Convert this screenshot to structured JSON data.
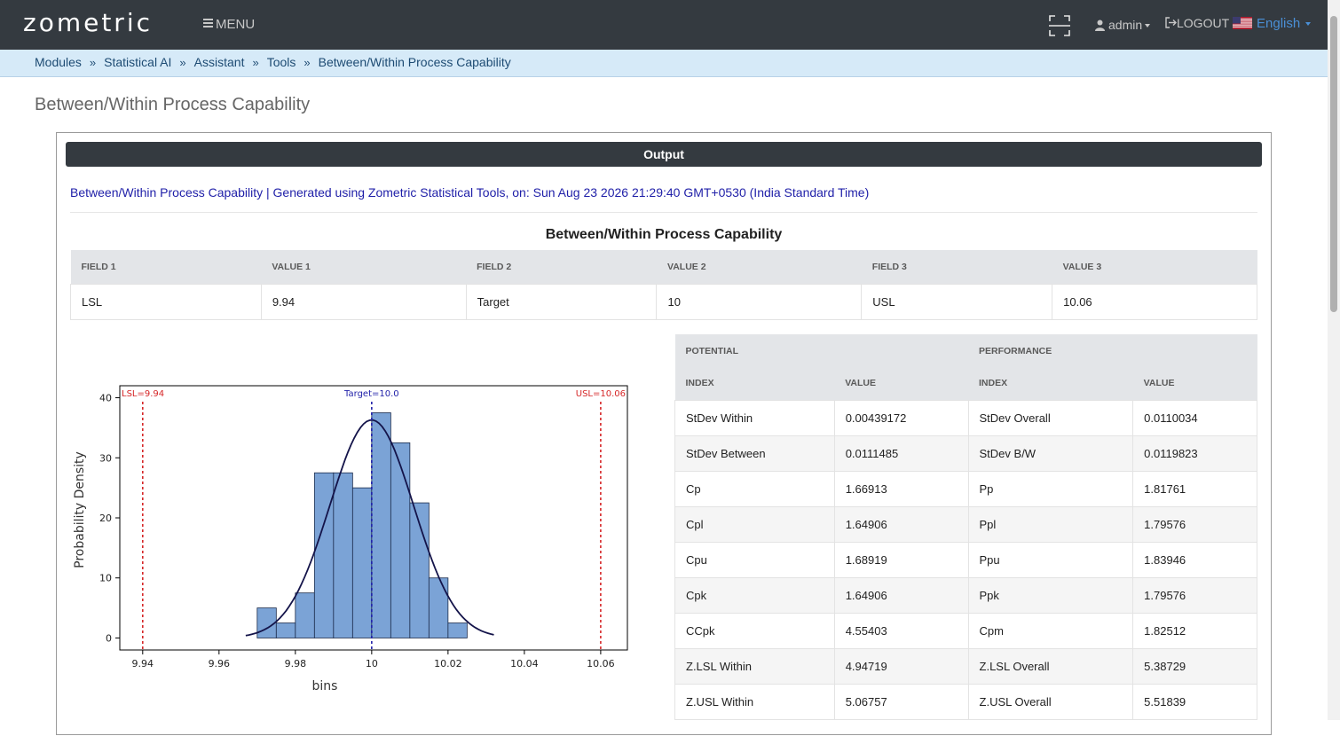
{
  "nav": {
    "logo": "zometric",
    "menu_label": "MENU",
    "user_label": "admin",
    "logout_label": "LOGOUT",
    "language_label": "English"
  },
  "breadcrumb": [
    "Modules",
    "Statistical AI",
    "Assistant",
    "Tools",
    "Between/Within Process Capability"
  ],
  "breadcrumb_sep": "»",
  "page_title": "Between/Within Process Capability",
  "output": {
    "header": "Output",
    "generated_text": "Between/Within Process Capability | Generated using Zometric Statistical Tools, on: Sun Aug 23 2026 21:29:40 GMT+0530 (India Standard Time)",
    "table_title": "Between/Within Process Capability"
  },
  "spec_table": {
    "headers": [
      "FIELD 1",
      "VALUE 1",
      "FIELD 2",
      "VALUE 2",
      "FIELD 3",
      "VALUE 3"
    ],
    "row": [
      "LSL",
      "9.94",
      "Target",
      "10",
      "USL",
      "10.06"
    ]
  },
  "capability_table": {
    "group_headers": [
      "POTENTIAL",
      "PERFORMANCE"
    ],
    "headers": [
      "INDEX",
      "VALUE",
      "INDEX",
      "VALUE"
    ],
    "rows": [
      [
        "StDev Within",
        "0.00439172",
        "StDev Overall",
        "0.0110034"
      ],
      [
        "StDev Between",
        "0.0111485",
        "StDev B/W",
        "0.0119823"
      ],
      [
        "Cp",
        "1.66913",
        "Pp",
        "1.81761"
      ],
      [
        "Cpl",
        "1.64906",
        "Ppl",
        "1.79576"
      ],
      [
        "Cpu",
        "1.68919",
        "Ppu",
        "1.83946"
      ],
      [
        "Cpk",
        "1.64906",
        "Ppk",
        "1.79576"
      ],
      [
        "CCpk",
        "4.55403",
        "Cpm",
        "1.82512"
      ],
      [
        "Z.LSL Within",
        "4.94719",
        "Z.LSL Overall",
        "5.38729"
      ],
      [
        "Z.USL Within",
        "5.06757",
        "Z.USL Overall",
        "5.51839"
      ]
    ]
  },
  "chart_data": {
    "type": "bar",
    "xlabel": "bins",
    "ylabel": "Probability Density",
    "xlim": [
      9.934,
      10.067
    ],
    "ylim": [
      -2,
      42
    ],
    "xticks": [
      9.94,
      9.96,
      9.98,
      10,
      10.02,
      10.04,
      10.06
    ],
    "xtick_labels": [
      "9.94",
      "9.96",
      "9.98",
      "10",
      "10.02",
      "10.04",
      "10.06"
    ],
    "yticks": [
      0,
      10,
      20,
      30,
      40
    ],
    "bin_width": 0.005,
    "bins": [
      {
        "x0": 9.97,
        "value": 5
      },
      {
        "x0": 9.975,
        "value": 2.5
      },
      {
        "x0": 9.98,
        "value": 7.5
      },
      {
        "x0": 9.985,
        "value": 27.5
      },
      {
        "x0": 9.99,
        "value": 27.5
      },
      {
        "x0": 9.995,
        "value": 25
      },
      {
        "x0": 10.0,
        "value": 37.5
      },
      {
        "x0": 10.005,
        "value": 32.5
      },
      {
        "x0": 10.01,
        "value": 22.5
      },
      {
        "x0": 10.015,
        "value": 10
      },
      {
        "x0": 10.02,
        "value": 2.5
      }
    ],
    "normal_curve": {
      "mean": 10.0,
      "sd": 0.011,
      "peak": 36.3,
      "x_range": [
        9.967,
        10.032
      ]
    },
    "reference_lines": [
      {
        "label": "LSL=9.94",
        "value": 9.94,
        "color": "#d62728",
        "anchor": "left"
      },
      {
        "label": "Target=10.0",
        "value": 10.0,
        "color": "#1f1fa8",
        "anchor": "middle"
      },
      {
        "label": "USL=10.06",
        "value": 10.06,
        "color": "#d62728",
        "anchor": "right"
      }
    ],
    "bar_color": "#7ba3d6",
    "curve_color": "#14144a"
  }
}
